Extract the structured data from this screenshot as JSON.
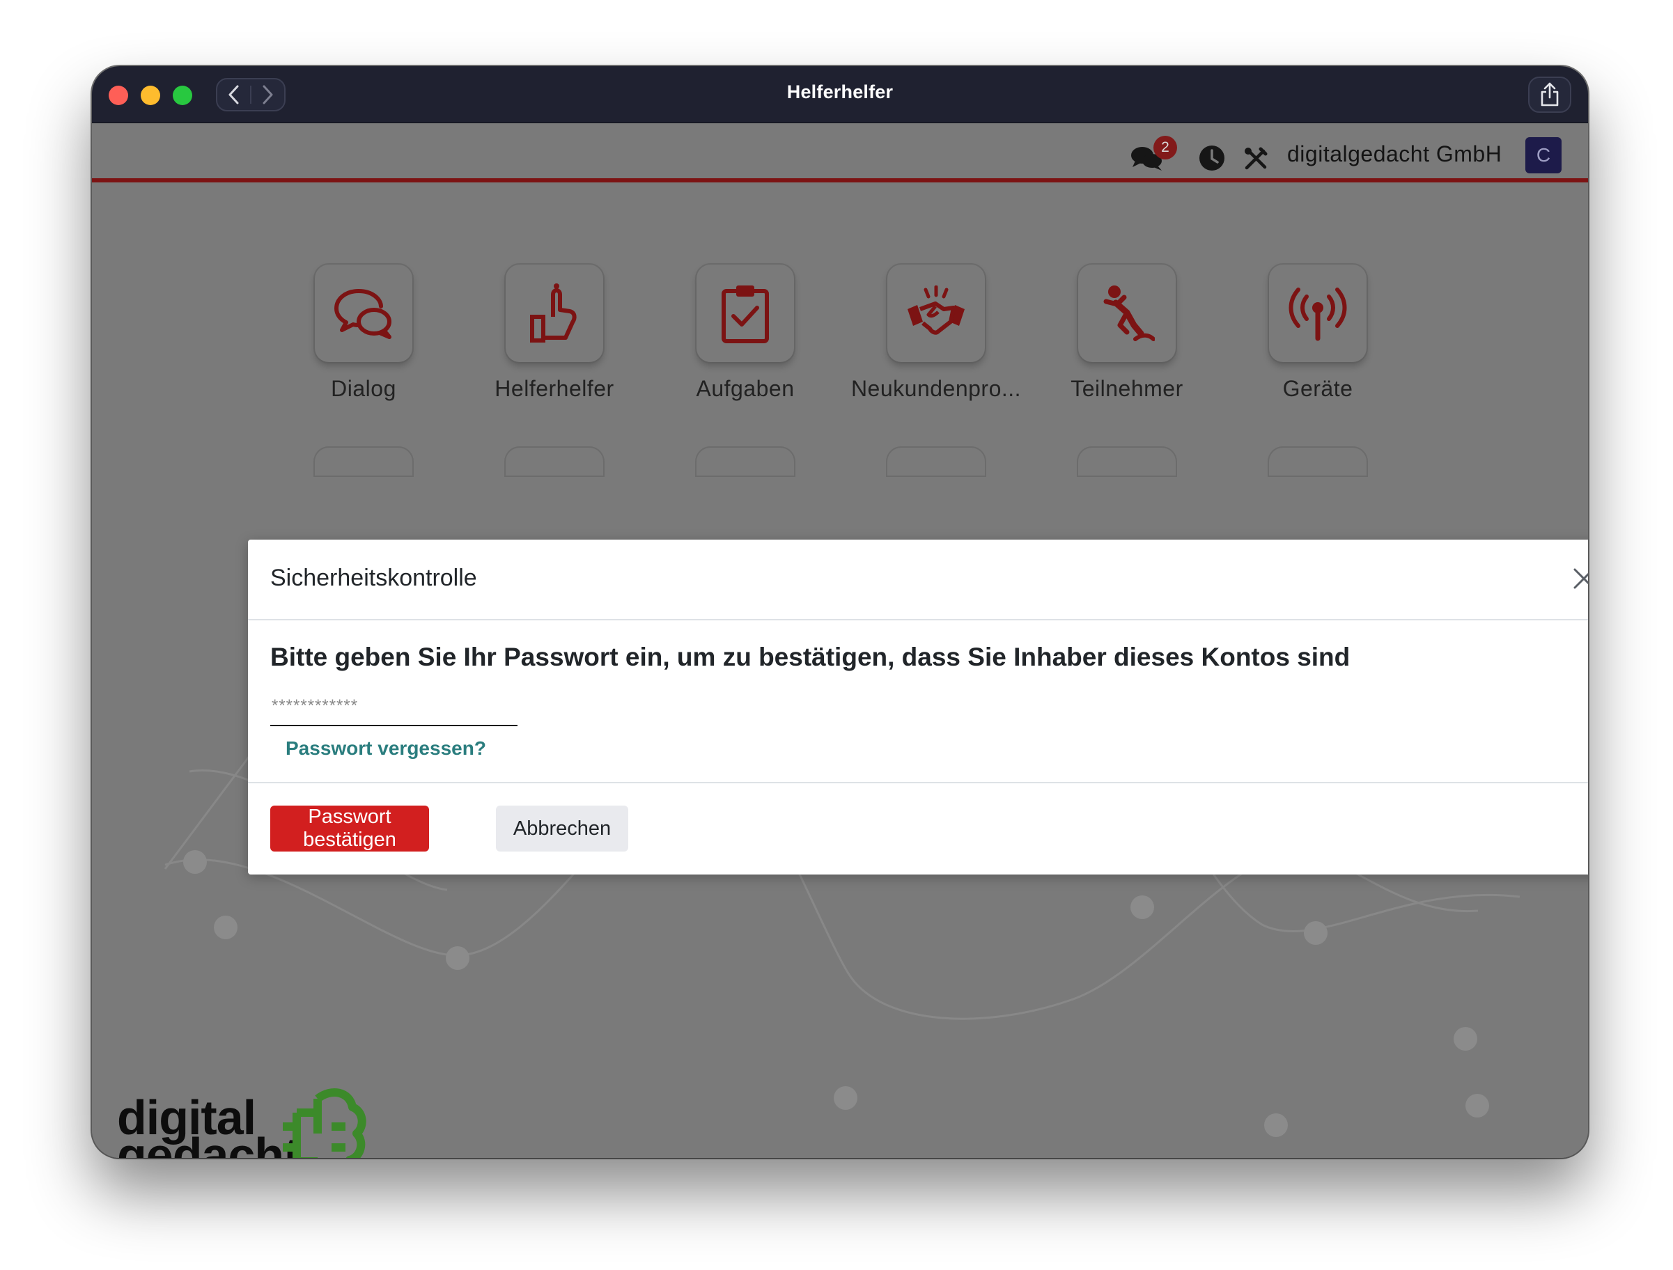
{
  "window": {
    "title": "Helferhelfer"
  },
  "header": {
    "chat_badge": "2",
    "company": "digitalgedacht GmbH",
    "avatar_initial": "C"
  },
  "apps": [
    {
      "label": "Dialog",
      "icon": "chat-bubbles-icon"
    },
    {
      "label": "Helferhelfer",
      "icon": "helping-hand-icon"
    },
    {
      "label": "Aufgaben",
      "icon": "clipboard-check-icon"
    },
    {
      "label": "Neukundenpro...",
      "icon": "handshake-icon"
    },
    {
      "label": "Teilnehmer",
      "icon": "person-falling-icon"
    },
    {
      "label": "Geräte",
      "icon": "broadcast-antenna-icon"
    }
  ],
  "logo": {
    "line1": "digital",
    "line2": "gedacht"
  },
  "modal": {
    "title": "Sicherheitskontrolle",
    "prompt": "Bitte geben Sie Ihr Passwort ein, um zu bestätigen, dass Sie Inhaber dieses Kontos sind",
    "password_placeholder": "************",
    "forgot_link": "Passwort vergessen?",
    "confirm_button": "Passwort bestätigen",
    "cancel_button": "Abbrechen"
  },
  "colors": {
    "accent": "#d21f1f",
    "link": "#2a7d7e",
    "icon_red": "#7c1313",
    "titlebar": "#1f2130"
  }
}
